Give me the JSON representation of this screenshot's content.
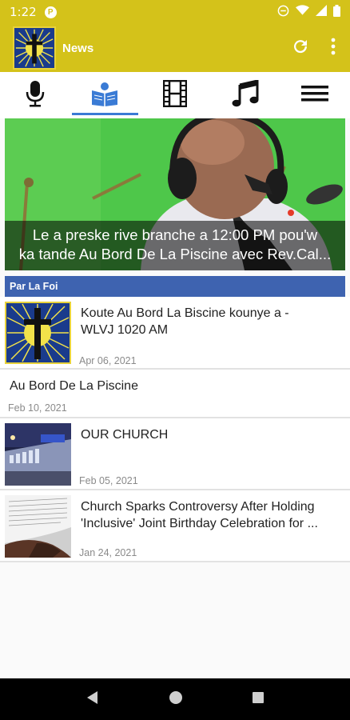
{
  "status_bar": {
    "time": "1:22"
  },
  "app_bar": {
    "title": "News"
  },
  "tabs": [
    {
      "name": "radio",
      "icon": "microphone-icon",
      "active": false
    },
    {
      "name": "news",
      "icon": "reading-book-icon",
      "active": true
    },
    {
      "name": "video",
      "icon": "film-strip-icon",
      "active": false
    },
    {
      "name": "music",
      "icon": "music-note-icon",
      "active": false
    },
    {
      "name": "menu",
      "icon": "hamburger-menu-icon",
      "active": false
    }
  ],
  "hero": {
    "caption_line1": "Le a preske rive branche a 12:00 PM  pou'w",
    "caption_line2": "ka tande Au Bord De La Piscine avec Rev.Cal..."
  },
  "section": {
    "title": "Par La Foi"
  },
  "articles": [
    {
      "title_line1": "Koute Au Bord La Biscine kounye a -",
      "title_line2": "WLVJ 1020 AM",
      "date": "Apr 06, 2021",
      "thumb": "logo"
    },
    {
      "title_line1": "Au Bord De La Piscine",
      "title_line2": "",
      "date": "Feb 10, 2021",
      "thumb": "none"
    },
    {
      "title_line1": "OUR CHURCH",
      "title_line2": "",
      "date": "Feb 05, 2021",
      "thumb": "church"
    },
    {
      "title_line1": "Church Sparks Controversy After Holding",
      "title_line2": "'Inclusive' Joint Birthday Celebration for ...",
      "date": "Jan 24, 2021",
      "thumb": "book"
    }
  ],
  "colors": {
    "accent": "#d4c21a",
    "section": "#3e63b0",
    "tab_indicator": "#3a7bd5"
  }
}
